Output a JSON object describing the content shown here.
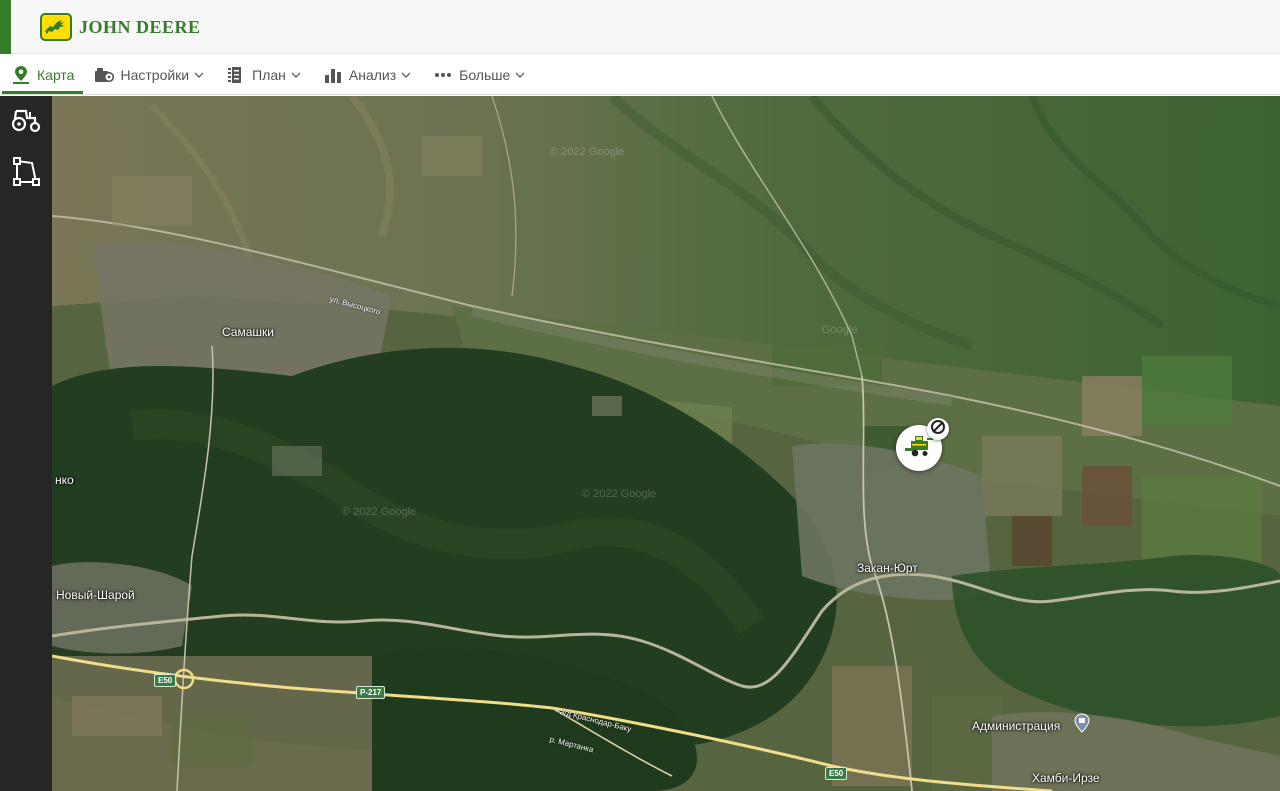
{
  "header": {
    "brand": "JOHN DEERE",
    "colors": {
      "brand_green": "#367c2b",
      "brand_yellow": "#ffde00"
    }
  },
  "nav": {
    "items": [
      {
        "label": "Карта",
        "icon": "map-pin-icon",
        "active": true,
        "dropdown": false
      },
      {
        "label": "Настройки",
        "icon": "settings-icon",
        "active": false,
        "dropdown": true
      },
      {
        "label": "План",
        "icon": "plan-icon",
        "active": false,
        "dropdown": true
      },
      {
        "label": "Анализ",
        "icon": "analysis-icon",
        "active": false,
        "dropdown": true
      },
      {
        "label": "Больше",
        "icon": "more-icon",
        "active": false,
        "dropdown": true
      }
    ]
  },
  "sidebar": {
    "items": [
      {
        "icon": "tractor-icon"
      },
      {
        "icon": "boundary-icon"
      }
    ]
  },
  "map": {
    "places": {
      "samashki": "Самашки",
      "novy_sharoy": "Новый-Шарой",
      "zakan_yurt": "Закан-Юрт",
      "administration": "Администрация",
      "khambi_irze": "Хамби-Ирзе",
      "edge_partial": "нко"
    },
    "roads": {
      "vysotskogo": "ул. Высоцкого",
      "r217": "Р-217",
      "e50_left": "E50",
      "e50_right": "E50",
      "krasnodar_baku": "а/д Краснодар-Баку",
      "martan": "р. Мартанка"
    },
    "watermarks": {
      "w1": "© 2022 Google",
      "w2": "Google",
      "w3": "© 2022 Google",
      "w4": "© 2022 Google"
    },
    "machine": {
      "icon": "combine-harvester-icon",
      "status_icon": "no-connection-icon"
    },
    "poi_icon": "building-pin-icon"
  }
}
